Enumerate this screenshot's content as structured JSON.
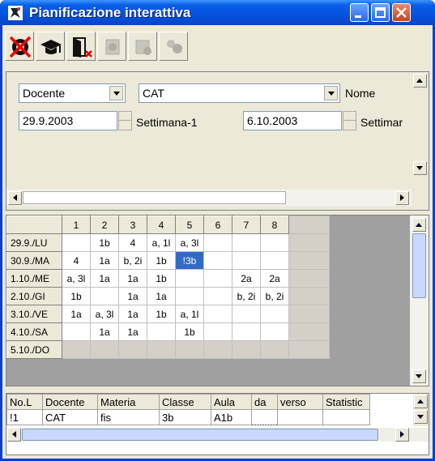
{
  "window": {
    "title": "Pianificazione interattiva"
  },
  "toolbar": {
    "icons": [
      "no-entry-icon",
      "graduation-cap-icon",
      "exit-door-icon",
      "disabled-tool-1-icon",
      "disabled-tool-2-icon",
      "disabled-tool-3-icon"
    ]
  },
  "filters": {
    "type_select": "Docente",
    "name_select": "CAT",
    "name_label": "Nome",
    "date_from": "29.9.2003",
    "week_label_1": "Settimana-1",
    "date_to": "6.10.2003",
    "week_label_2": "Settimar"
  },
  "grid": {
    "columns": [
      "1",
      "2",
      "3",
      "4",
      "5",
      "6",
      "7",
      "8"
    ],
    "rows": [
      {
        "day": "29.9./LU",
        "cells": [
          "",
          "1b",
          "4",
          "a, 1l",
          "a, 3l",
          "",
          "",
          ""
        ]
      },
      {
        "day": "30.9./MA",
        "cells": [
          "4",
          "1a",
          "b, 2i",
          "1b",
          "!3b",
          "",
          "",
          ""
        ]
      },
      {
        "day": "1.10./ME",
        "cells": [
          "a, 3l",
          "1a",
          "1a",
          "1b",
          "",
          "",
          "2a",
          "2a"
        ]
      },
      {
        "day": "2.10./GI",
        "cells": [
          "1b",
          "",
          "1a",
          "1a",
          "",
          "",
          "b, 2i",
          "b, 2i"
        ]
      },
      {
        "day": "3.10./VE",
        "cells": [
          "1a",
          "a, 3l",
          "1a",
          "1b",
          "a, 1l",
          "",
          "",
          ""
        ]
      },
      {
        "day": "4.10./SA",
        "cells": [
          "",
          "1a",
          "1a",
          "",
          "1b",
          "",
          "",
          ""
        ]
      },
      {
        "day": "5.10./DO",
        "cells": [
          "",
          "",
          "",
          "",
          "",
          "",
          "",
          ""
        ]
      }
    ],
    "selected": {
      "row": 1,
      "col": 4
    }
  },
  "details": {
    "headers": [
      "No.L",
      "Docente",
      "Materia",
      "Classe",
      "Aula",
      "da",
      "verso",
      "Statistic"
    ],
    "row": [
      "!1",
      "CAT",
      "fis",
      "3b",
      "A1b",
      "",
      "",
      ""
    ]
  }
}
